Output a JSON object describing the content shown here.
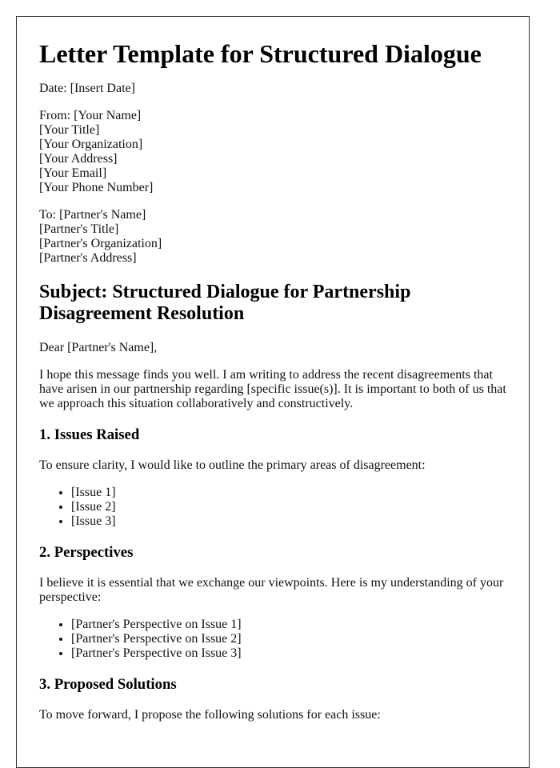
{
  "title": "Letter Template for Structured Dialogue",
  "date_line": "Date: [Insert Date]",
  "from": {
    "lines": [
      "From: [Your Name]",
      "[Your Title]",
      "[Your Organization]",
      "[Your Address]",
      "[Your Email]",
      "[Your Phone Number]"
    ]
  },
  "to": {
    "lines": [
      "To: [Partner's Name]",
      "[Partner's Title]",
      "[Partner's Organization]",
      "[Partner's Address]"
    ]
  },
  "subject": "Subject: Structured Dialogue for Partnership Disagreement Resolution",
  "salutation": "Dear [Partner's Name],",
  "intro_paragraph": "I hope this message finds you well. I am writing to address the recent disagreements that have arisen in our partnership regarding [specific issue(s)]. It is important to both of us that we approach this situation collaboratively and constructively.",
  "sections": [
    {
      "heading": "1. Issues Raised",
      "paragraph": "To ensure clarity, I would like to outline the primary areas of disagreement:",
      "items": [
        "[Issue 1]",
        "[Issue 2]",
        "[Issue 3]"
      ]
    },
    {
      "heading": "2. Perspectives",
      "paragraph": "I believe it is essential that we exchange our viewpoints. Here is my understanding of your perspective:",
      "items": [
        "[Partner's Perspective on Issue 1]",
        "[Partner's Perspective on Issue 2]",
        "[Partner's Perspective on Issue 3]"
      ]
    },
    {
      "heading": "3. Proposed Solutions",
      "paragraph": "To move forward, I propose the following solutions for each issue:",
      "items": []
    }
  ],
  "colors": {
    "border": "#333333",
    "text": "#111111",
    "background": "#ffffff"
  }
}
